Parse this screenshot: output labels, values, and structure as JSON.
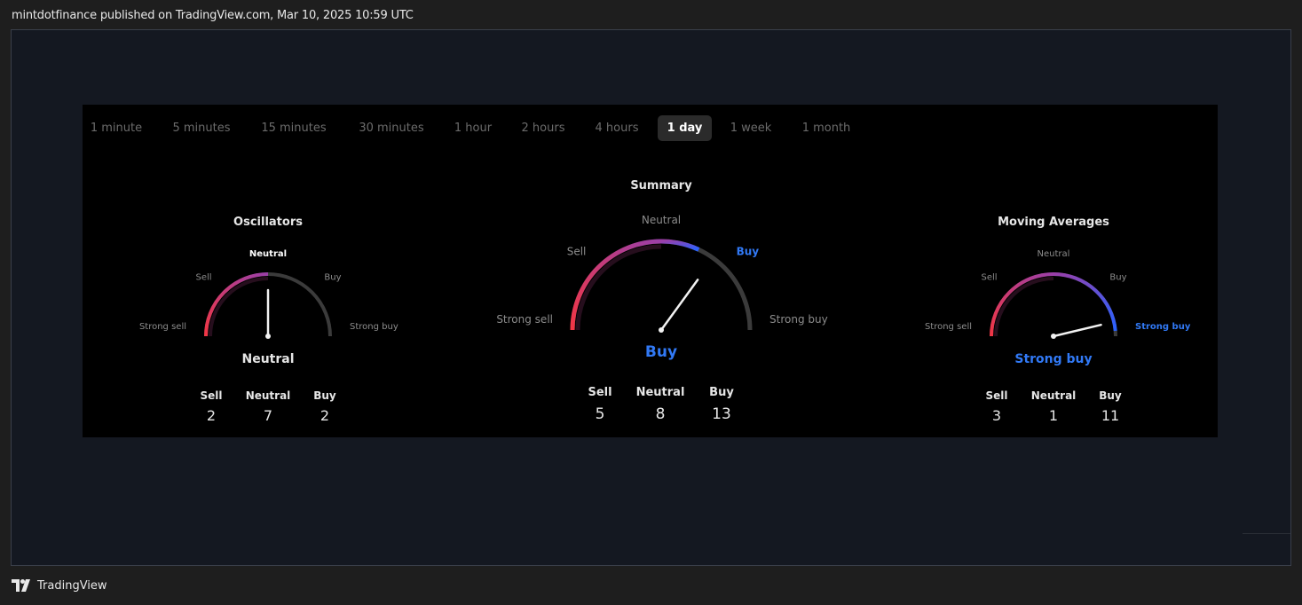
{
  "header": {
    "text": "mintdotfinance published on TradingView.com, Mar 10, 2025 10:59 UTC"
  },
  "tabs": [
    {
      "label": "1 minute",
      "active": false
    },
    {
      "label": "5 minutes",
      "active": false
    },
    {
      "label": "15 minutes",
      "active": false
    },
    {
      "label": "30 minutes",
      "active": false
    },
    {
      "label": "1 hour",
      "active": false
    },
    {
      "label": "2 hours",
      "active": false
    },
    {
      "label": "4 hours",
      "active": false
    },
    {
      "label": "1 day",
      "active": true
    },
    {
      "label": "1 week",
      "active": false
    },
    {
      "label": "1 month",
      "active": false
    }
  ],
  "gauges": {
    "oscillators": {
      "title": "Oscillators",
      "labels": {
        "strong_sell": "Strong sell",
        "sell": "Sell",
        "neutral": "Neutral",
        "buy": "Buy",
        "strong_buy": "Strong buy"
      },
      "result": "Neutral",
      "needle_level": 0.0,
      "counts": [
        {
          "label": "Sell",
          "value": "2"
        },
        {
          "label": "Neutral",
          "value": "7"
        },
        {
          "label": "Buy",
          "value": "2"
        }
      ]
    },
    "summary": {
      "title": "Summary",
      "labels": {
        "strong_sell": "Strong sell",
        "sell": "Sell",
        "neutral": "Neutral",
        "buy": "Buy",
        "strong_buy": "Strong buy"
      },
      "result": "Buy",
      "needle_level": 0.4,
      "counts": [
        {
          "label": "Sell",
          "value": "5"
        },
        {
          "label": "Neutral",
          "value": "8"
        },
        {
          "label": "Buy",
          "value": "13"
        }
      ]
    },
    "moving_averages": {
      "title": "Moving Averages",
      "labels": {
        "strong_sell": "Strong sell",
        "sell": "Sell",
        "neutral": "Neutral",
        "buy": "Buy",
        "strong_buy": "Strong buy"
      },
      "result": "Strong buy",
      "needle_level": 0.85,
      "counts": [
        {
          "label": "Sell",
          "value": "3"
        },
        {
          "label": "Neutral",
          "value": "1"
        },
        {
          "label": "Buy",
          "value": "11"
        }
      ]
    }
  },
  "colors": {
    "sell": "#f23645",
    "neutral_arc": "#9b3fa8",
    "buy": "#2962ff",
    "buy_text": "#3179f5",
    "track": "#3b3b3b",
    "inactive_label": "#8c8c8c"
  },
  "footer": {
    "brand": "TradingView",
    "logo_icon": "tradingview-logo-icon"
  }
}
